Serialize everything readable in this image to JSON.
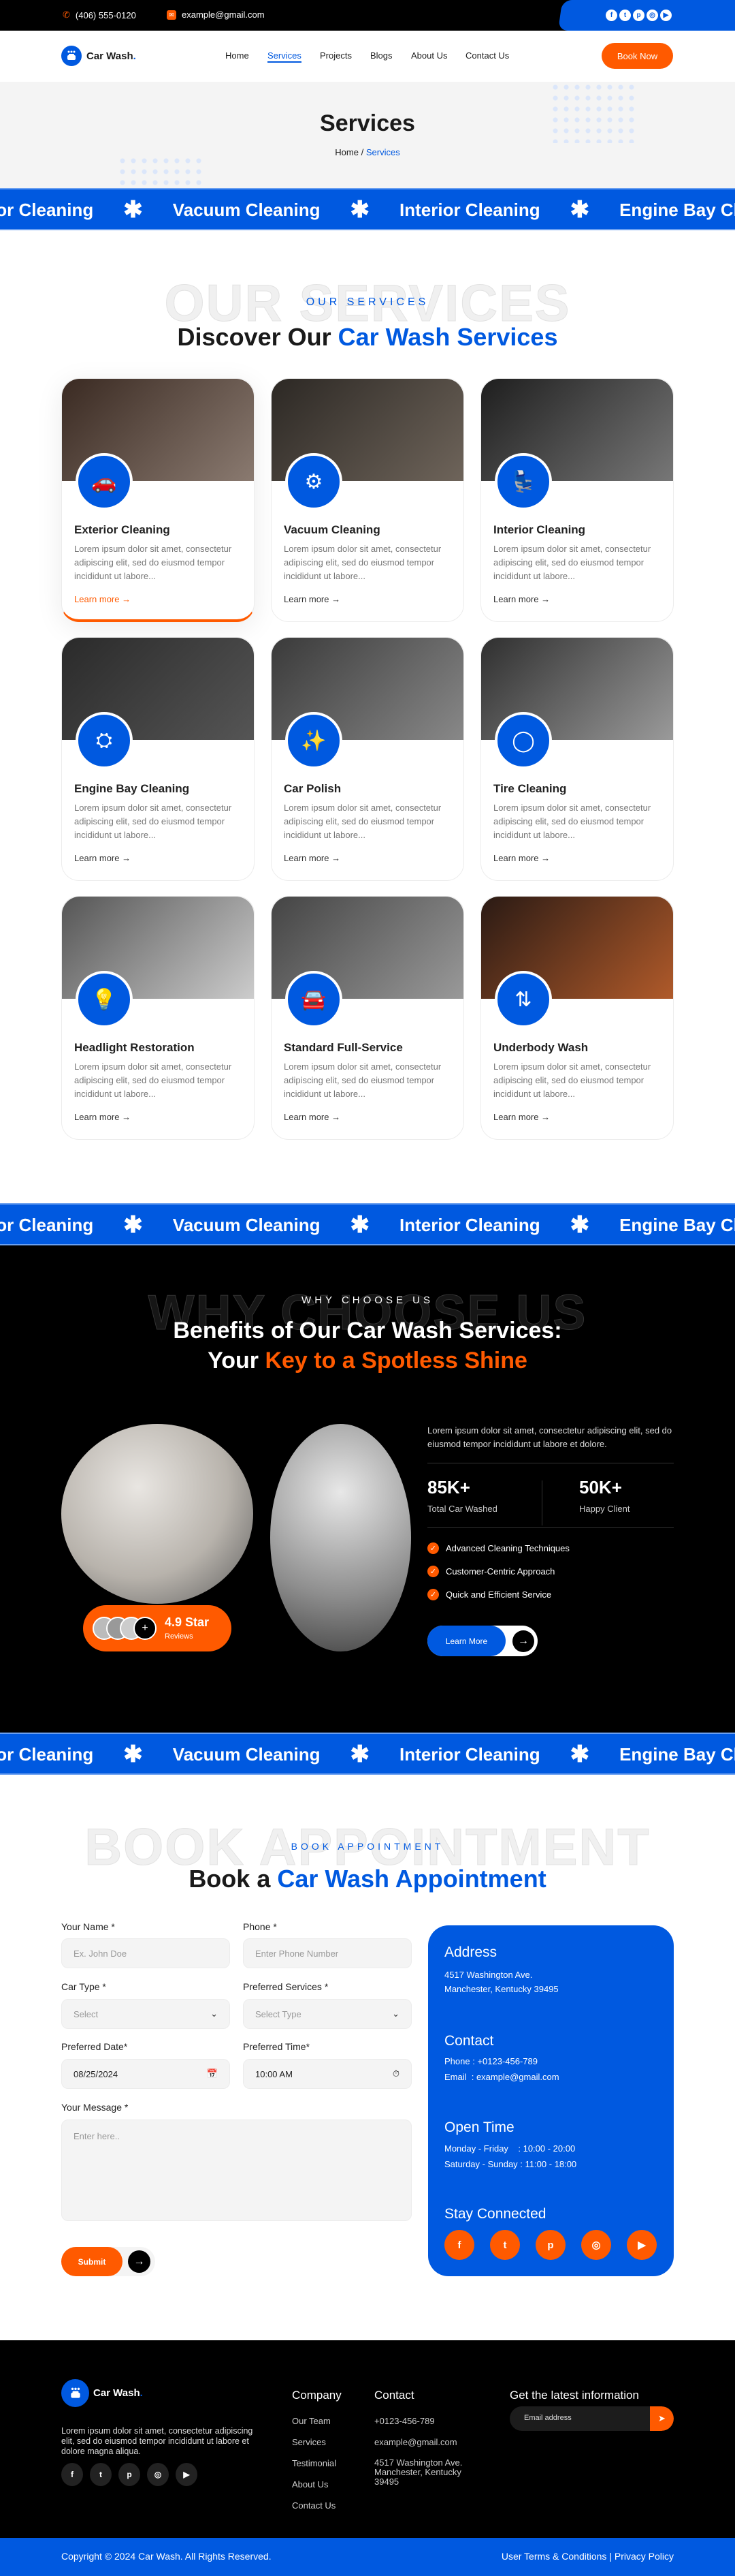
{
  "colors": {
    "brand_blue": "#0059e0",
    "accent_orange": "#ff5a00",
    "dark": "#000000"
  },
  "topbar": {
    "phone": "(406) 555-0120",
    "email": "example@gmail.com",
    "socials": [
      "facebook-icon",
      "twitter-icon",
      "pinterest-icon",
      "instagram-icon",
      "youtube-icon"
    ]
  },
  "nav": {
    "brand": "Car Wash",
    "brand_dot": ".",
    "links": [
      "Home",
      "Services",
      "Projects",
      "Blogs",
      "About Us",
      "Contact Us"
    ],
    "active": "Services",
    "book_now": "Book Now"
  },
  "banner": {
    "title": "Services",
    "crumb_home": "Home",
    "crumb_sep": "/",
    "crumb_current": "Services"
  },
  "marquee": {
    "items": [
      "Exterior Cleaning",
      "Vacuum Cleaning",
      "Interior Cleaning",
      "Engine Bay Cleaning"
    ]
  },
  "services": {
    "watermark": "OUR SERVICES",
    "eyebrow": "OUR SERVICES",
    "heading_pre": "Discover Our ",
    "heading_highlight": "Car Wash Services",
    "cards": [
      {
        "title": "Exterior Cleaning",
        "desc": "Lorem ipsum dolor sit amet, consectetur adipiscing elit, sed do eiusmod tempor incididunt ut labore...",
        "link": "Learn more",
        "icon": "car-wash-icon"
      },
      {
        "title": "Vacuum Cleaning",
        "desc": "Lorem ipsum dolor sit amet, consectetur adipiscing elit, sed do eiusmod tempor incididunt ut labore...",
        "link": "Learn more",
        "icon": "vacuum-icon"
      },
      {
        "title": "Interior Cleaning",
        "desc": "Lorem ipsum dolor sit amet, consectetur adipiscing elit, sed do eiusmod tempor incididunt ut labore...",
        "link": "Learn more",
        "icon": "car-seat-icon"
      },
      {
        "title": "Engine Bay Cleaning",
        "desc": "Lorem ipsum dolor sit amet, consectetur adipiscing elit, sed do eiusmod tempor incididunt ut labore...",
        "link": "Learn more",
        "icon": "engine-icon"
      },
      {
        "title": "Car Polish",
        "desc": "Lorem ipsum dolor sit amet, consectetur adipiscing elit, sed do eiusmod tempor incididunt ut labore...",
        "link": "Learn more",
        "icon": "polish-icon"
      },
      {
        "title": "Tire Cleaning",
        "desc": "Lorem ipsum dolor sit amet, consectetur adipiscing elit, sed do eiusmod tempor incididunt ut labore...",
        "link": "Learn more",
        "icon": "tire-icon"
      },
      {
        "title": "Headlight Restoration",
        "desc": "Lorem ipsum dolor sit amet, consectetur adipiscing elit, sed do eiusmod tempor incididunt ut labore...",
        "link": "Learn more",
        "icon": "headlight-icon"
      },
      {
        "title": "Standard Full-Service",
        "desc": "Lorem ipsum dolor sit amet, consectetur adipiscing elit, sed do eiusmod tempor incididunt ut labore...",
        "link": "Learn more",
        "icon": "full-service-icon"
      },
      {
        "title": "Underbody Wash",
        "desc": "Lorem ipsum dolor sit amet, consectetur adipiscing elit, sed do eiusmod tempor incididunt ut labore...",
        "link": "Learn more",
        "icon": "underbody-icon"
      }
    ]
  },
  "why": {
    "watermark": "WHY CHOOSE US",
    "eyebrow": "WHY CHOOSE US",
    "heading_line1": "Benefits of Our Car Wash Services:",
    "heading_line2_pre": "Your ",
    "heading_line2_highlight": "Key to a Spotless Shine",
    "rating": "4.9 Star",
    "rating_sub": "Reviews",
    "intro": "Lorem ipsum dolor sit amet, consectetur adipiscing elit, sed do eiusmod tempor incididunt ut labore et dolore.",
    "stats": [
      {
        "value": "85K+",
        "label": "Total Car Washed"
      },
      {
        "value": "50K+",
        "label": "Happy Client"
      }
    ],
    "features": [
      "Advanced Cleaning Techniques",
      "Customer-Centric Approach",
      "Quick and Efficient Service"
    ],
    "learn_more": "Learn More"
  },
  "book": {
    "watermark": "BOOK APPOINTMENT",
    "eyebrow": "BOOK APPOINTMENT",
    "heading_pre": "Book a ",
    "heading_highlight": "Car Wash Appointment",
    "form": {
      "name_label": "Your Name *",
      "name_placeholder": "Ex. John Doe",
      "phone_label": "Phone *",
      "phone_placeholder": "Enter Phone Number",
      "car_label": "Car Type *",
      "car_value": "Select",
      "service_label": "Preferred Services *",
      "service_value": "Select Type",
      "date_label": "Preferred Date*",
      "date_value": "08/25/2024",
      "time_label": "Preferred Time*",
      "time_value": "10:00 AM",
      "message_label": "Your Message *",
      "message_placeholder": "Enter here..",
      "submit": "Submit"
    },
    "contact": {
      "address_title": "Address",
      "address_line1": "4517 Washington Ave.",
      "address_line2": "Manchester, Kentucky 39495",
      "contact_title": "Contact",
      "phone": "Phone : +0123-456-789",
      "email": "Email  : example@gmail.com",
      "open_title": "Open Time",
      "hours1": "Monday - Friday    : 10:00 - 20:00",
      "hours2": "Saturday - Sunday : 11:00 - 18:00",
      "stay_title": "Stay Connected"
    }
  },
  "footer": {
    "brand": "Car Wash",
    "brand_dot": ".",
    "about": "Lorem ipsum dolor sit amet, consectetur adipiscing elit, sed do eiusmod tempor incididunt ut labore et dolore magna aliqua.",
    "company_title": "Company",
    "company_links": [
      "Our Team",
      "Services",
      "Testimonial",
      "About Us",
      "Contact Us"
    ],
    "contact_title": "Contact",
    "contact_phone": "+0123-456-789",
    "contact_email": "example@gmail.com",
    "contact_address": "4517 Washington Ave. Manchester, Kentucky 39495",
    "newsletter_title": "Get the latest information",
    "newsletter_placeholder": "Email address",
    "copyright": "Copyright © 2024 Car Wash. All Rights Reserved.",
    "terms": "User Terms & Conditions",
    "privacy": "Privacy Policy"
  }
}
